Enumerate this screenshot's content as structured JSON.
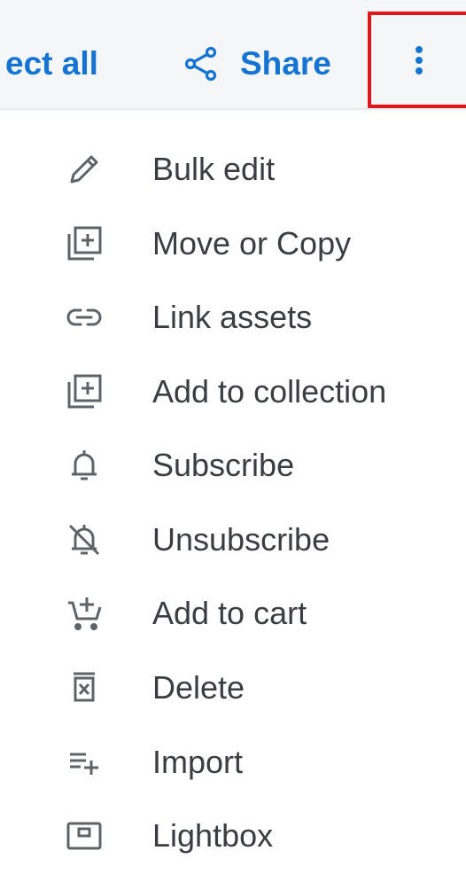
{
  "toolbar": {
    "select_all_label": "ect all",
    "share_label": "Share"
  },
  "menu": {
    "items": [
      {
        "label": "Bulk edit",
        "icon": "pencil-icon"
      },
      {
        "label": "Move or Copy",
        "icon": "library-add-icon"
      },
      {
        "label": "Link assets",
        "icon": "link-icon"
      },
      {
        "label": "Add to collection",
        "icon": "library-add-icon"
      },
      {
        "label": "Subscribe",
        "icon": "bell-icon"
      },
      {
        "label": "Unsubscribe",
        "icon": "bell-off-icon"
      },
      {
        "label": "Add to cart",
        "icon": "add-to-cart-icon"
      },
      {
        "label": "Delete",
        "icon": "delete-box-icon"
      },
      {
        "label": "Import",
        "icon": "playlist-add-icon"
      },
      {
        "label": "Lightbox",
        "icon": "lightbox-icon"
      }
    ]
  },
  "colors": {
    "accent": "#1474d3",
    "highlight_border": "#e0161a",
    "icon": "#5f6368",
    "text": "#3b3d41"
  }
}
